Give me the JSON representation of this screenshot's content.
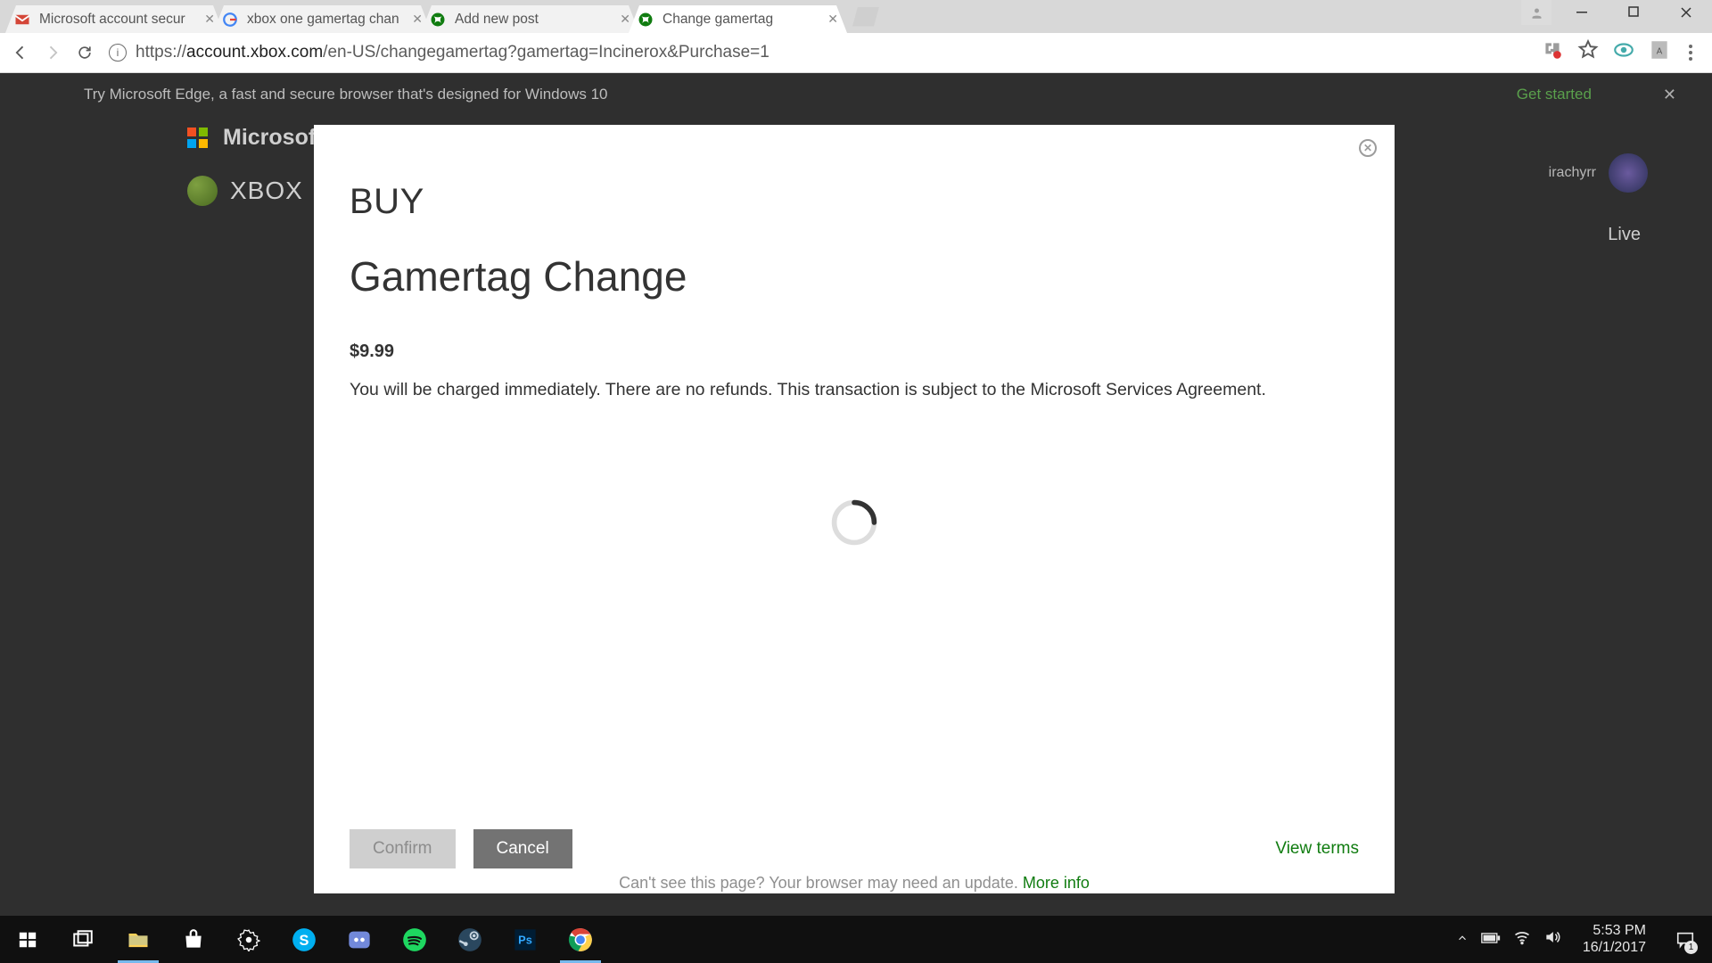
{
  "browser": {
    "tabs": [
      {
        "title": "Microsoft account secur",
        "active": false
      },
      {
        "title": "xbox one gamertag chan",
        "active": false
      },
      {
        "title": "Add new post",
        "active": false
      },
      {
        "title": "Change gamertag",
        "active": true
      }
    ],
    "url_display_prefix": "https://",
    "url_host": "account.xbox.com",
    "url_path": "/en-US/changegamertag?gamertag=Incinerox&Purchase=1"
  },
  "edge_banner": {
    "message": "Try Microsoft Edge, a fast and secure browser that's designed for Windows 10",
    "cta": "Get started"
  },
  "site": {
    "microsoft_label": "Microsoft",
    "xbox_label": "XBOX",
    "username": "irachyrr",
    "live_label": "Live"
  },
  "modal": {
    "heading": "BUY",
    "product_title": "Gamertag Change",
    "price": "$9.99",
    "description": "You will be charged immediately. There are no refunds. This transaction is subject to the Microsoft Services Agreement.",
    "confirm_label": "Confirm",
    "cancel_label": "Cancel",
    "view_terms_label": "View terms",
    "subline_text": "Can't see this page? Your browser may need an update. ",
    "subline_link": "More info"
  },
  "taskbar": {
    "clock_time": "5:53 PM",
    "clock_date": "16/1/2017",
    "notification_count": "1"
  }
}
